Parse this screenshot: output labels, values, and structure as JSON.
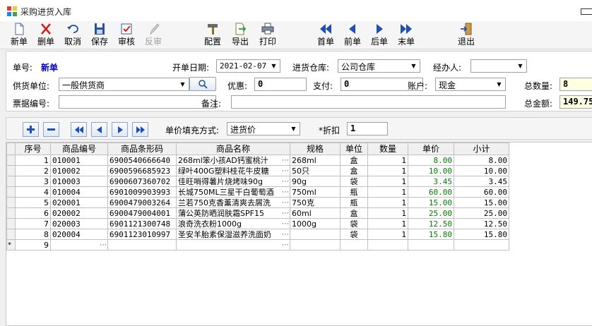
{
  "window": {
    "title": "采购进货入库",
    "accent": "#0000cc"
  },
  "toolbar": {
    "new": "新单",
    "delete": "删单",
    "cancel": "取消",
    "save": "保存",
    "audit": "审核",
    "unaudit": "反审",
    "config": "配置",
    "export": "导出",
    "print": "打印",
    "first": "首单",
    "prev": "前单",
    "next": "后单",
    "last": "末单",
    "exit": "退出"
  },
  "form": {
    "order_no_label": "单号:",
    "order_no_value": "新单",
    "date_label": "开单日期:",
    "date_value": "2021-02-07",
    "warehouse_label": "进货仓库:",
    "warehouse_value": "公司仓库",
    "handler_label": "经办人:",
    "handler_value": "",
    "supplier_label": "供货单位:",
    "supplier_value": "一般供货商",
    "discount_label": "优惠:",
    "discount_value": "0",
    "pay_label": "支付:",
    "pay_value": "0",
    "account_label": "账户:",
    "account_value": "现金",
    "total_qty_label": "总数量:",
    "total_qty_value": "8",
    "invoice_label": "票据编号:",
    "invoice_value": "",
    "remark_label": "备注:",
    "remark_value": "",
    "total_amount_label": "总金额:",
    "total_amount_value": "149.75"
  },
  "subbar": {
    "price_mode_label": "单价填充方式:",
    "price_mode_value": "进货价",
    "rebate_label": "*折扣",
    "rebate_value": "1"
  },
  "grid": {
    "headers": [
      "序号",
      "商品编号",
      "商品条形码",
      "商品名称",
      "规格",
      "单位",
      "数量",
      "单价",
      "小计"
    ],
    "rows": [
      {
        "seq": "1",
        "code": "010001",
        "barcode": "6900540666640",
        "name": "268ml笨小孩AD钙蜜桃汁",
        "spec": "268ml",
        "unit": "盒",
        "qty": "1",
        "price": "8.00",
        "subtotal": "8.00"
      },
      {
        "seq": "2",
        "code": "010002",
        "barcode": "6900596685923",
        "name": "绿叶400G塑料桂花牛皮糖",
        "spec": "50只",
        "unit": "盒",
        "qty": "1",
        "price": "10.00",
        "subtotal": "10.00"
      },
      {
        "seq": "3",
        "code": "010003",
        "barcode": "6900607360702",
        "name": "佳旺哨得薯片烧烤味90g",
        "spec": "90g",
        "unit": "袋",
        "qty": "1",
        "price": "3.45",
        "subtotal": "3.45"
      },
      {
        "seq": "4",
        "code": "010004",
        "barcode": "6901009903993",
        "name": "长城750ML三星干白葡萄酒",
        "spec": "750ml",
        "unit": "瓶",
        "qty": "1",
        "price": "60.00",
        "subtotal": "60.00"
      },
      {
        "seq": "5",
        "code": "020001",
        "barcode": "6900479003264",
        "name": "兰若750克香薰清爽去屑洗",
        "spec": "750克",
        "unit": "瓶",
        "qty": "1",
        "price": "15.00",
        "subtotal": "15.00"
      },
      {
        "seq": "6",
        "code": "020002",
        "barcode": "6900479004001",
        "name": "蒲公英防晒润肤霜SPF15",
        "spec": "60ml",
        "unit": "盒",
        "qty": "1",
        "price": "25.00",
        "subtotal": "25.00"
      },
      {
        "seq": "7",
        "code": "020003",
        "barcode": "6901121300748",
        "name": "浪奇洗衣粉1000g",
        "spec": "1000g",
        "unit": "袋",
        "qty": "1",
        "price": "12.50",
        "subtotal": "12.50"
      },
      {
        "seq": "8",
        "code": "020004",
        "barcode": "6901123010997",
        "name": "圣安羊胎素保湿滋养洗面奶",
        "spec": "",
        "unit": "袋",
        "qty": "1",
        "price": "15.80",
        "subtotal": "15.80"
      }
    ],
    "new_row": {
      "indicator": "*",
      "seq": "9"
    }
  }
}
